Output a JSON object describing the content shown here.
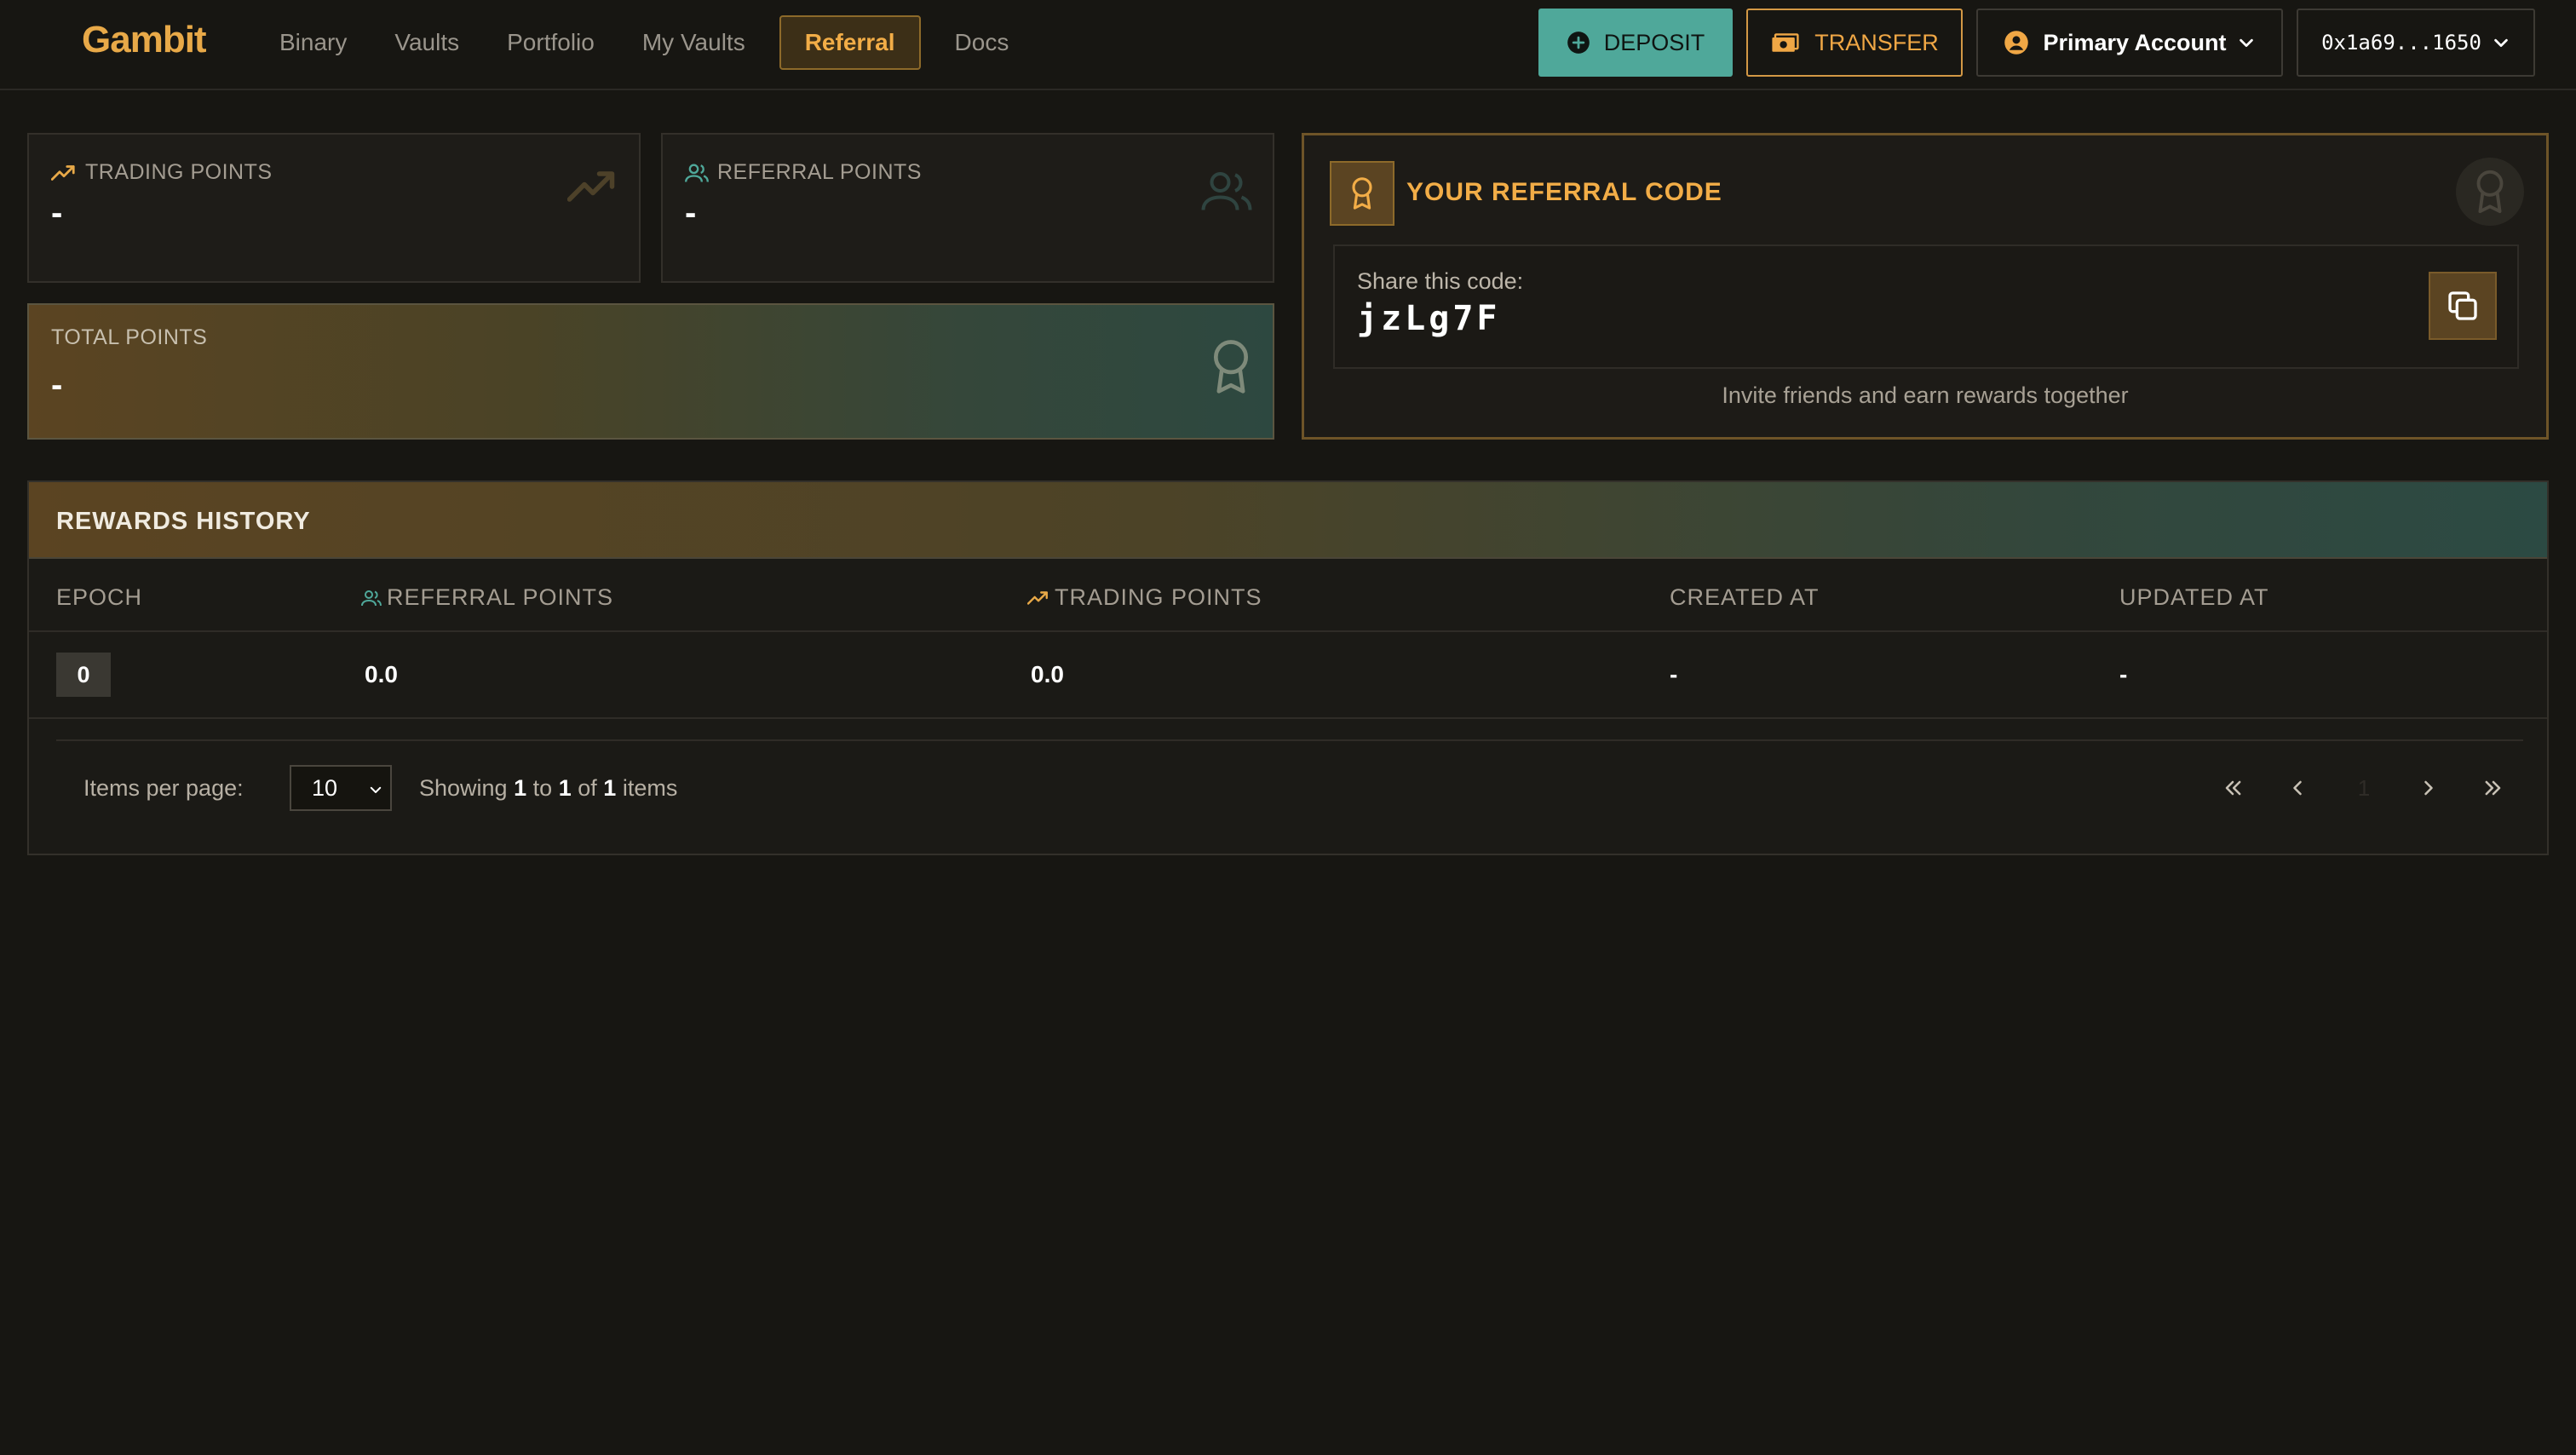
{
  "brand": "Gambit",
  "nav": [
    {
      "label": "Binary"
    },
    {
      "label": "Vaults"
    },
    {
      "label": "Portfolio"
    },
    {
      "label": "My Vaults"
    },
    {
      "label": "Referral",
      "active": true
    },
    {
      "label": "Docs"
    }
  ],
  "actions": {
    "deposit": "DEPOSIT",
    "transfer": "TRANSFER",
    "account": "Primary Account",
    "wallet": "0x1a69...1650"
  },
  "stats": {
    "trading_label": "TRADING POINTS",
    "trading_value": "-",
    "referral_label": "REFERRAL POINTS",
    "referral_value": "-",
    "total_label": "TOTAL POINTS",
    "total_value": "-"
  },
  "referral": {
    "title": "YOUR REFERRAL CODE",
    "share_label": "Share this code:",
    "code": "jzLg7F",
    "invite_text": "Invite friends and earn rewards together"
  },
  "rewards": {
    "title": "REWARDS HISTORY",
    "columns": [
      "EPOCH",
      "REFERRAL POINTS",
      "TRADING POINTS",
      "CREATED AT",
      "UPDATED AT"
    ],
    "rows": [
      {
        "epoch": "0",
        "referral_points": "0.0",
        "trading_points": "0.0",
        "created_at": "-",
        "updated_at": "-"
      }
    ],
    "pagination": {
      "items_per_page_label": "Items per page:",
      "items_per_page": "10",
      "showing_prefix": "Showing",
      "from": "1",
      "to_word": "to",
      "to": "1",
      "of_word": "of",
      "total": "1",
      "items_word": "items",
      "current_page": "1"
    }
  },
  "colors": {
    "accent": "#f2ad47",
    "teal": "#4fa89a",
    "background": "#171612"
  }
}
